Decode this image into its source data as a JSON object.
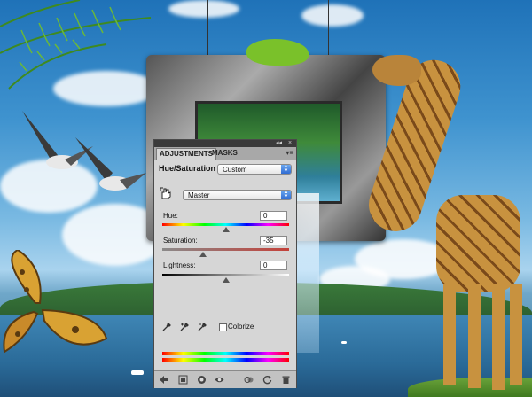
{
  "panel": {
    "tabs": [
      {
        "label": "ADJUSTMENTS",
        "active": true
      },
      {
        "label": "MASKS",
        "active": false
      }
    ],
    "collapse_glyph": "◂◂",
    "close_glyph": "×",
    "menu_glyph": "▾≡",
    "title": "Hue/Saturation",
    "preset": {
      "selected": "Custom"
    },
    "channel": {
      "selected": "Master"
    },
    "hue": {
      "label": "Hue:",
      "value": "0"
    },
    "saturation": {
      "label": "Saturation:",
      "value": "-35"
    },
    "lightness": {
      "label": "Lightness:",
      "value": "0"
    },
    "colorize": {
      "label": "Colorize",
      "checked": false
    }
  },
  "icons": {
    "targeted_adjustment": "hand-icon",
    "eyedroppers": [
      "eyedropper-icon",
      "eyedropper-plus-icon",
      "eyedropper-minus-icon"
    ],
    "bottom_bar": [
      "back-arrow-icon",
      "clip-layer-icon",
      "eye-icon",
      "view-previous-icon",
      "reset-icon",
      "trash-icon"
    ]
  },
  "colors": {
    "panel_bg": "#d6d6d6",
    "select_arrow": "#2f6bd2"
  }
}
